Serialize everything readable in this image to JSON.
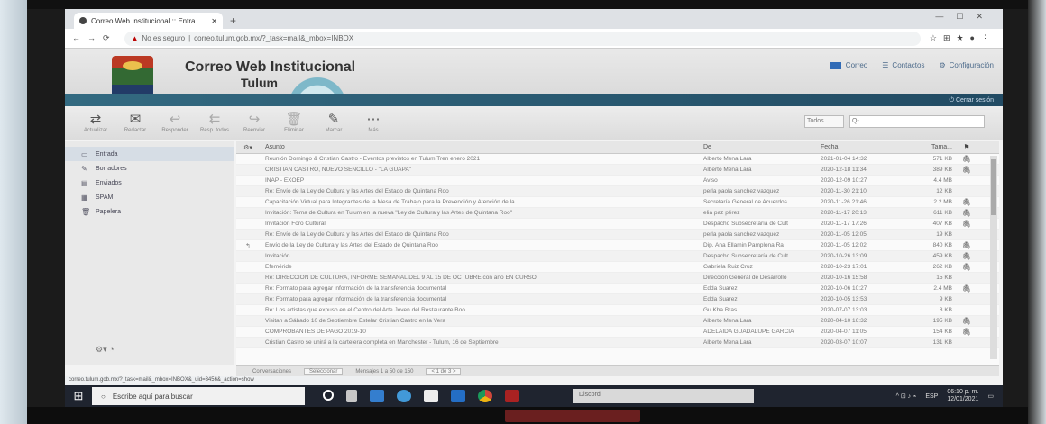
{
  "browser": {
    "tab_title": "Correo Web Institucional :: Entra",
    "url_warning": "No es seguro",
    "url": "correo.tulum.gob.mx/?_task=mail&_mbox=INBOX"
  },
  "app": {
    "title_line1": "Correo Web Institucional",
    "title_line2": "Tulum",
    "nav": {
      "mail": "Correo",
      "contacts": "Contactos",
      "settings": "Configuración"
    },
    "logout": "Cerrar sesión"
  },
  "toolbar": {
    "buttons": [
      {
        "label": "Actualizar",
        "icon": "refresh-icon"
      },
      {
        "label": "Redactar",
        "icon": "compose-icon"
      },
      {
        "label": "Responder",
        "icon": "reply-icon"
      },
      {
        "label": "Resp. todos",
        "icon": "reply-all-icon"
      },
      {
        "label": "Reenviar",
        "icon": "forward-icon"
      },
      {
        "label": "Eliminar",
        "icon": "delete-icon"
      },
      {
        "label": "Marcar",
        "icon": "mark-icon"
      },
      {
        "label": "Más",
        "icon": "more-icon"
      }
    ],
    "search_select": "Todos",
    "search_placeholder": "Q-"
  },
  "folders": [
    {
      "name": "Entrada",
      "active": true
    },
    {
      "name": "Borradores",
      "active": false
    },
    {
      "name": "Enviados",
      "active": false
    },
    {
      "name": "SPAM",
      "active": false
    },
    {
      "name": "Papelera",
      "active": false
    }
  ],
  "list": {
    "columns": {
      "subject": "Asunto",
      "from": "De",
      "date": "Fecha",
      "size": "Tama..."
    },
    "rows": [
      {
        "subject": "Reunión Domingo & Cristian Castro - Eventos previstos en Tulum Tren enero 2021",
        "from": "Alberto Mena Lara",
        "date": "2021-01-04 14:32",
        "size": "571 KB",
        "att": true
      },
      {
        "subject": "CRISTIAN CASTRO, NUEVO SENCILLO - \"LA GUAPA\"",
        "from": "Alberto Mena Lara",
        "date": "2020-12-18 11:34",
        "size": "389 KB",
        "att": true
      },
      {
        "subject": "INAP - EXOEP",
        "from": "Aviso",
        "date": "2020-12-09 10:27",
        "size": "4.4 MB",
        "att": false
      },
      {
        "subject": "Re: Envío de la Ley de Cultura y las Artes del Estado de Quintana Roo",
        "from": "perla paola sanchez vazquez",
        "date": "2020-11-30 21:10",
        "size": "12 KB",
        "att": false
      },
      {
        "subject": "Capacitación Virtual para Integrantes de la Mesa de Trabajo para la Prevención y Atención de la",
        "from": "Secretaría General de Acuerdos",
        "date": "2020-11-26 21:46",
        "size": "2.2 MB",
        "att": true
      },
      {
        "subject": "Invitación: Tema de Cultura en Tulum en la nueva \"Ley de Cultura y las Artes de Quintana Roo\"",
        "from": "elia paz pérez",
        "date": "2020-11-17 20:13",
        "size": "611 KB",
        "att": true
      },
      {
        "subject": "Invitación Foro Cultural",
        "from": "Despacho Subsecretaría de Cult",
        "date": "2020-11-17 17:26",
        "size": "407 KB",
        "att": true
      },
      {
        "subject": "Re: Envío de la Ley de Cultura y las Artes del Estado de Quintana Roo",
        "from": "perla paola sanchez vazquez",
        "date": "2020-11-05 12:05",
        "size": "19 KB",
        "att": false
      },
      {
        "subject": "Envío de la Ley de Cultura y las Artes del Estado de Quintana Roo",
        "from": "Dip. Ana Ellamin Pamplona Ra",
        "date": "2020-11-05 12:02",
        "size": "840 KB",
        "att": true
      },
      {
        "subject": "Invitación",
        "from": "Despacho Subsecretaría de Cult",
        "date": "2020-10-26 13:09",
        "size": "459 KB",
        "att": true
      },
      {
        "subject": "Efeméride",
        "from": "Gabriela Ruiz Cruz",
        "date": "2020-10-23 17:01",
        "size": "262 KB",
        "att": true
      },
      {
        "subject": "Re: DIRECCIÓN DE CULTURA, INFORME SEMANAL DEL 9 AL 15 DE OCTUBRE con año EN CURSO",
        "from": "Dirección General de Desarrollo",
        "date": "2020-10-16 15:58",
        "size": "15 KB",
        "att": false
      },
      {
        "subject": "Re: Formato para agregar información de la transferencia documental",
        "from": "Edda Suarez",
        "date": "2020-10-06 10:27",
        "size": "2.4 MB",
        "att": true
      },
      {
        "subject": "Re: Formato para agregar información de la transferencia documental",
        "from": "Edda Suarez",
        "date": "2020-10-05 13:53",
        "size": "9 KB",
        "att": false
      },
      {
        "subject": "Re: Los artistas que expuso en el Centro del Arte Joven del Restaurante Boo",
        "from": "Gu Kha Bras",
        "date": "2020-07-07 13:03",
        "size": "8 KB",
        "att": false
      },
      {
        "subject": "Visitan a Sábado 10 de Septiembre Estelar Cristian Castro en la Vera",
        "from": "Alberto Mena Lara",
        "date": "2020-04-10 16:32",
        "size": "195 KB",
        "att": true
      },
      {
        "subject": "COMPROBANTES DE PAGO 2019-10",
        "from": "ADELAIDA GUADALUPE GARCÍA",
        "date": "2020-04-07 11:05",
        "size": "154 KB",
        "att": true
      },
      {
        "subject": "Cristian Castro se unirá a la cartelera completa en Manchester - Tulum, 16 de Septiembre",
        "from": "Alberto Mena Lara",
        "date": "2020-03-07 10:07",
        "size": "131 KB",
        "att": false
      }
    ]
  },
  "statusbar": {
    "threads": "Conversaciones",
    "select": "Seleccionar",
    "count": "Mensajes 1 a 50 de 150",
    "pages": "< 1 de 3 >"
  },
  "url_status": "correo.tulum.gob.mx/?_task=mail&_mbox=INBOX&_uid=3456&_action=show",
  "taskbar": {
    "search_placeholder": "Escribe aquí para buscar",
    "lang": "ESP",
    "time": "06:10 p. m.",
    "date": "12/01/2021",
    "discord": "Discord"
  },
  "colors": {
    "accent": "#2e6b85",
    "taskbar": "#1f2430",
    "sidebar_active": "#d5dde6"
  }
}
